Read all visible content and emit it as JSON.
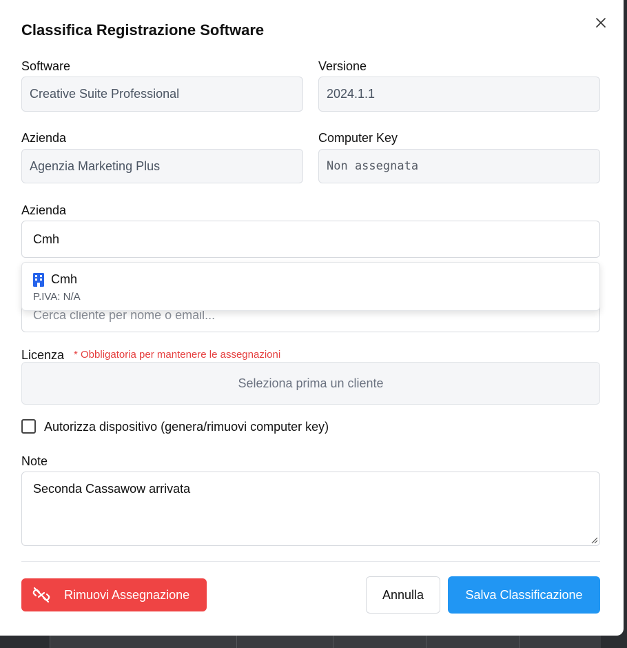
{
  "modal": {
    "title": "Classifica Registrazione Software"
  },
  "fields": {
    "software_label": "Software",
    "software_value": "Creative Suite Professional",
    "version_label": "Versione",
    "version_value": "2024.1.1",
    "company_label": "Azienda",
    "company_value": "Agenzia Marketing Plus",
    "computer_key_label": "Computer Key",
    "computer_key_value": "Non assegnata"
  },
  "client": {
    "label": "Azienda",
    "input_value": "Cmh",
    "search_placeholder": "Cerca cliente per nome o email...",
    "suggestion": {
      "name": "Cmh",
      "icon": "building-icon",
      "vat": "P.IVA: N/A"
    }
  },
  "license": {
    "label": "Licenza",
    "required_note": "* Obbligatoria per mantenere le assegnazioni",
    "placeholder": "Seleziona prima un cliente"
  },
  "authorize": {
    "label": "Autorizza dispositivo (genera/rimuovi computer key)",
    "checked": false
  },
  "notes": {
    "label": "Note",
    "value": "Seconda Cassawow arrivata"
  },
  "buttons": {
    "remove": "Rimuovi Assegnazione",
    "cancel": "Annulla",
    "save": "Salva Classificazione"
  },
  "colors": {
    "danger": "#ef4444",
    "primary": "#2196f3",
    "required": "#e53e3e",
    "icon_blue": "#2563eb"
  }
}
